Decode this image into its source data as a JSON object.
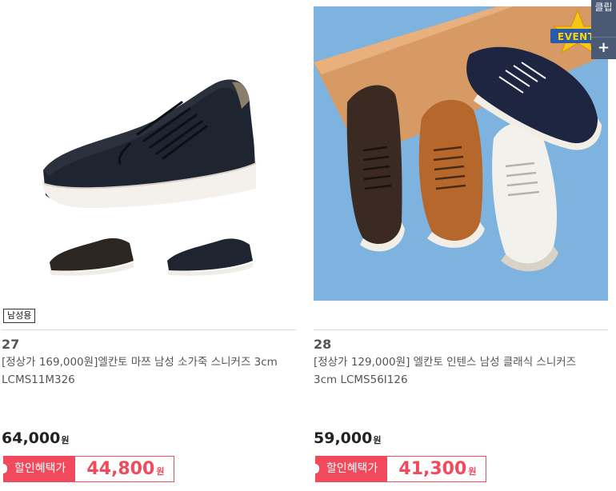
{
  "products": [
    {
      "rank": "27",
      "tag": "남성용",
      "title": "[정상가 169,000원]엘칸토 마쯔 남성 소가죽 스니커즈 3cm LCMS11M326",
      "price": "64,000",
      "price_unit": "원",
      "discount_label": "할인혜택가",
      "discount_price": "44,800",
      "discount_unit": "원"
    },
    {
      "rank": "28",
      "title": "[정상가 129,000원] 엘칸토 인텐스 남성 클래식 스니커즈 3cm LCMS56I126",
      "price": "59,000",
      "price_unit": "원",
      "discount_label": "할인혜택가",
      "discount_price": "41,300",
      "discount_unit": "원",
      "event_badge": "EVENT"
    }
  ],
  "side_panel": {
    "clip_label": "클립",
    "plus_label": "+"
  },
  "colors": {
    "accent": "#f04a5c",
    "side_panel": "#4a5a74",
    "image_bg_right": "#7fb3df"
  }
}
